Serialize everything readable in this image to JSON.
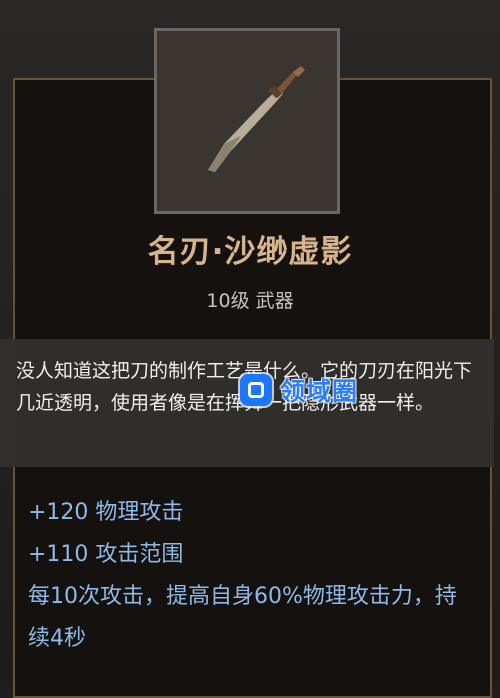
{
  "item": {
    "icon": "sword-icon",
    "name": "名刃·沙缈虚影",
    "subtitle": "10级 武器"
  },
  "tooltip": {
    "description": "没人知道这把刀的制作工艺是什么。它的刀刃在阳光下几近透明，使用者像是在挥舞一把隐形武器一样。"
  },
  "stats": {
    "line1": "+120 物理攻击",
    "line2": "+110 攻击范围",
    "line3": "每10次攻击，提高自身60%物理攻击力，持续4秒"
  },
  "watermark": {
    "text": "领域圈"
  }
}
